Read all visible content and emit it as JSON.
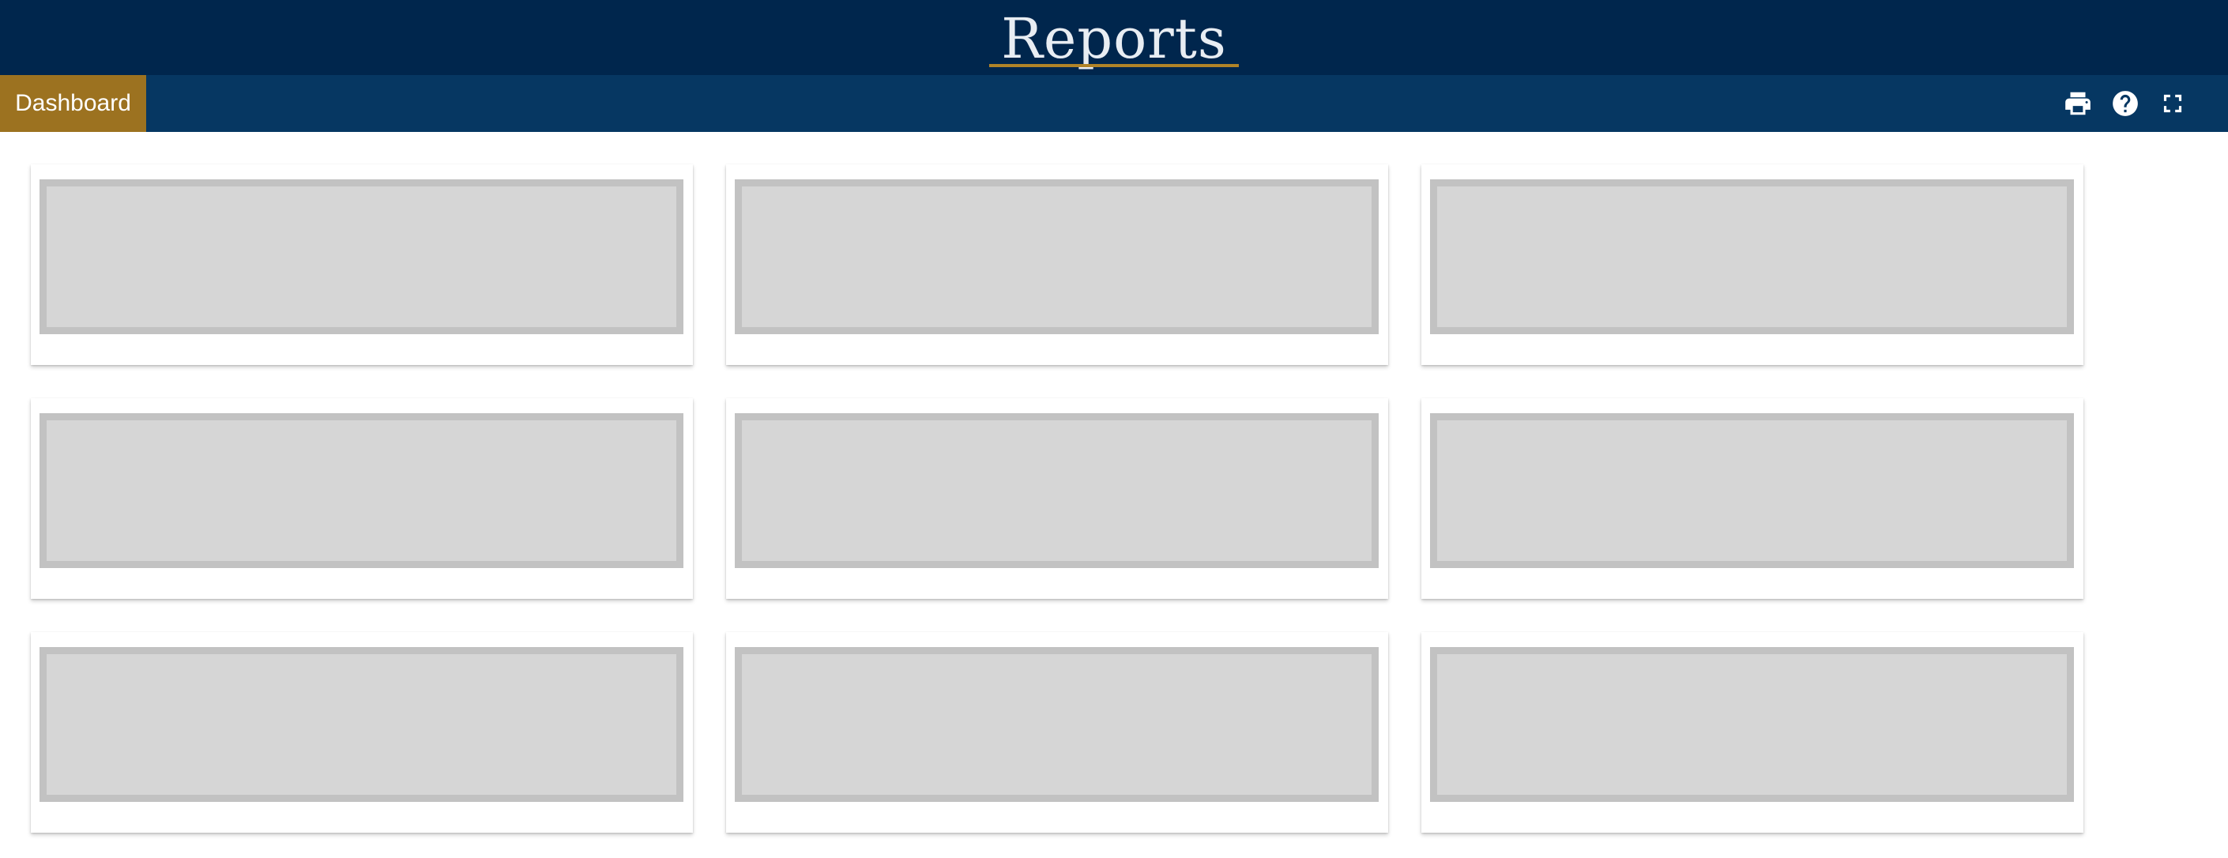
{
  "header": {
    "title": "Reports"
  },
  "nav": {
    "dashboard_label": "Dashboard",
    "icons": [
      "print-icon",
      "help-icon",
      "fullscreen-icon"
    ]
  },
  "colors": {
    "title_bar": "#00264d",
    "nav_bar": "#063762",
    "accent": "#9c7220",
    "underline": "#b08428",
    "placeholder_fill": "#d6d6d6",
    "placeholder_border": "#c2c2c2"
  },
  "cards": [
    {
      "state": "loading"
    },
    {
      "state": "loading"
    },
    {
      "state": "loading"
    },
    {
      "state": "loading"
    },
    {
      "state": "loading"
    },
    {
      "state": "loading"
    },
    {
      "state": "loading"
    },
    {
      "state": "loading"
    },
    {
      "state": "loading"
    }
  ]
}
